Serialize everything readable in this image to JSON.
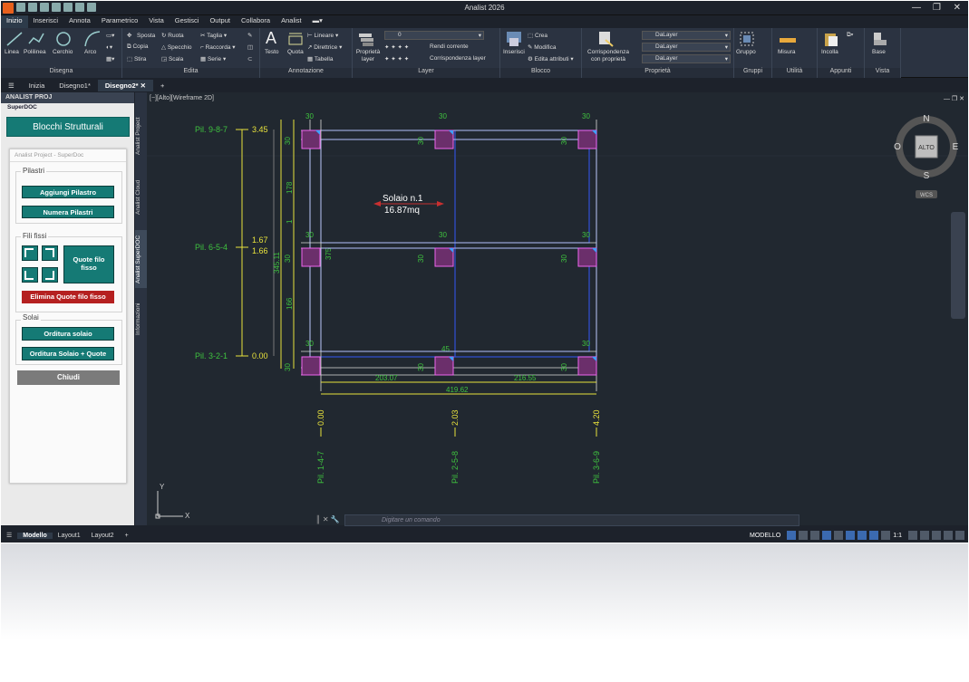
{
  "window": {
    "title": "Analist 2026"
  },
  "menu": {
    "items": [
      "Inizio",
      "Inserisci",
      "Annota",
      "Parametrico",
      "Vista",
      "Gestisci",
      "Output",
      "Collabora",
      "Analist"
    ]
  },
  "ribbon": {
    "disegna": {
      "label": "Disegna",
      "linea": "Linea",
      "polilinea": "Polilinea",
      "cerchio": "Cerchio",
      "arco": "Arco"
    },
    "edita": {
      "label": "Edita",
      "sposta": "Sposta",
      "ruota": "Ruota",
      "taglia": "Taglia",
      "copia": "Copia",
      "specchio": "Specchio",
      "raccorda": "Raccorda",
      "stira": "Stira",
      "scala": "Scala",
      "serie": "Serie"
    },
    "annotazione": {
      "label": "Annotazione",
      "testo": "Testo",
      "quota": "Quota",
      "lineare": "Lineare",
      "direttrice": "Direttrice",
      "tabella": "Tabella"
    },
    "layer": {
      "label": "Layer",
      "proprieta": "Proprietà layer",
      "current": "0",
      "rendi": "Rendi corrente",
      "corrispondenza": "Corrispondenza layer"
    },
    "blocco": {
      "label": "Blocco",
      "inserisci": "Inserisci",
      "crea": "Crea",
      "modifica": "Modifica",
      "edita_attributi": "Edita attributi"
    },
    "proprieta": {
      "label": "Proprietà",
      "corrispondenza": "Corrispondenza con proprietà",
      "color": "DaLayer",
      "linetype": "DaLayer",
      "lineweight": "DaLayer"
    },
    "gruppi": {
      "label": "Gruppi",
      "gruppo": "Gruppo"
    },
    "utilita": {
      "label": "Utilità",
      "misura": "Misura"
    },
    "appunti": {
      "label": "Appunti",
      "incolla": "Incolla"
    },
    "vista": {
      "label": "Vista",
      "base": "Base"
    }
  },
  "doctabs": [
    "Inizia",
    "Disegno1*",
    "Disegno2*"
  ],
  "panel": {
    "header": "ANALIST PROJ",
    "sub": "SuperDOC",
    "blocchi": "Blocchi Strutturali",
    "inner_title": "Analist Project - SuperDoc",
    "pilastri": "Pilastri",
    "aggiungi": "Aggiungi Pilastro",
    "numera": "Numera Pilastri",
    "fili": "Fili fissi",
    "quote_filo": "Quote filo fisso",
    "elimina": "Elimina Quote filo fisso",
    "solai": "Solai",
    "orditura": "Orditura solaio",
    "orditura_quote": "Orditura Solaio + Quote",
    "chiudi": "Chiudi"
  },
  "vtabs": [
    "Analist Project",
    "Analist Cloud",
    "Analist SuperDOC",
    "Informazioni"
  ],
  "viewport": {
    "label": "[−][Alto][Wireframe 2D]"
  },
  "drawing": {
    "levels": [
      {
        "name": "Pil. 9-8-7",
        "value": "3.45"
      },
      {
        "name": "Pil. 6-5-4",
        "value": "1.67",
        "value2": "1.66"
      },
      {
        "name": "Pil. 3-2-1",
        "value": "0.00"
      }
    ],
    "columns": [
      {
        "name": "Pil. 1-4-7",
        "value": "0.00"
      },
      {
        "name": "Pil. 2-5-8",
        "value": "2.03"
      },
      {
        "name": "Pil. 3-6-9",
        "value": "4.20"
      }
    ],
    "solaio": {
      "name": "Solaio n.1",
      "area": "16.87mq"
    },
    "dims": {
      "col_w": "30",
      "left_total": "345.11",
      "seg1": "178",
      "seg2": "1",
      "seg3": "166",
      "bottom1": "203.07",
      "bottom2": "216.55",
      "total": "419.62",
      "mid1": "375",
      "mid2": "45"
    }
  },
  "viewcube": {
    "n": "N",
    "s": "S",
    "e": "E",
    "o": "O",
    "center": "ALTO",
    "wcs": "WCS"
  },
  "cmdline": {
    "placeholder": "Digitare un comando"
  },
  "layouts": [
    "Modello",
    "Layout1",
    "Layout2"
  ],
  "status": {
    "modello": "MODELLO",
    "scale": "1:1"
  }
}
